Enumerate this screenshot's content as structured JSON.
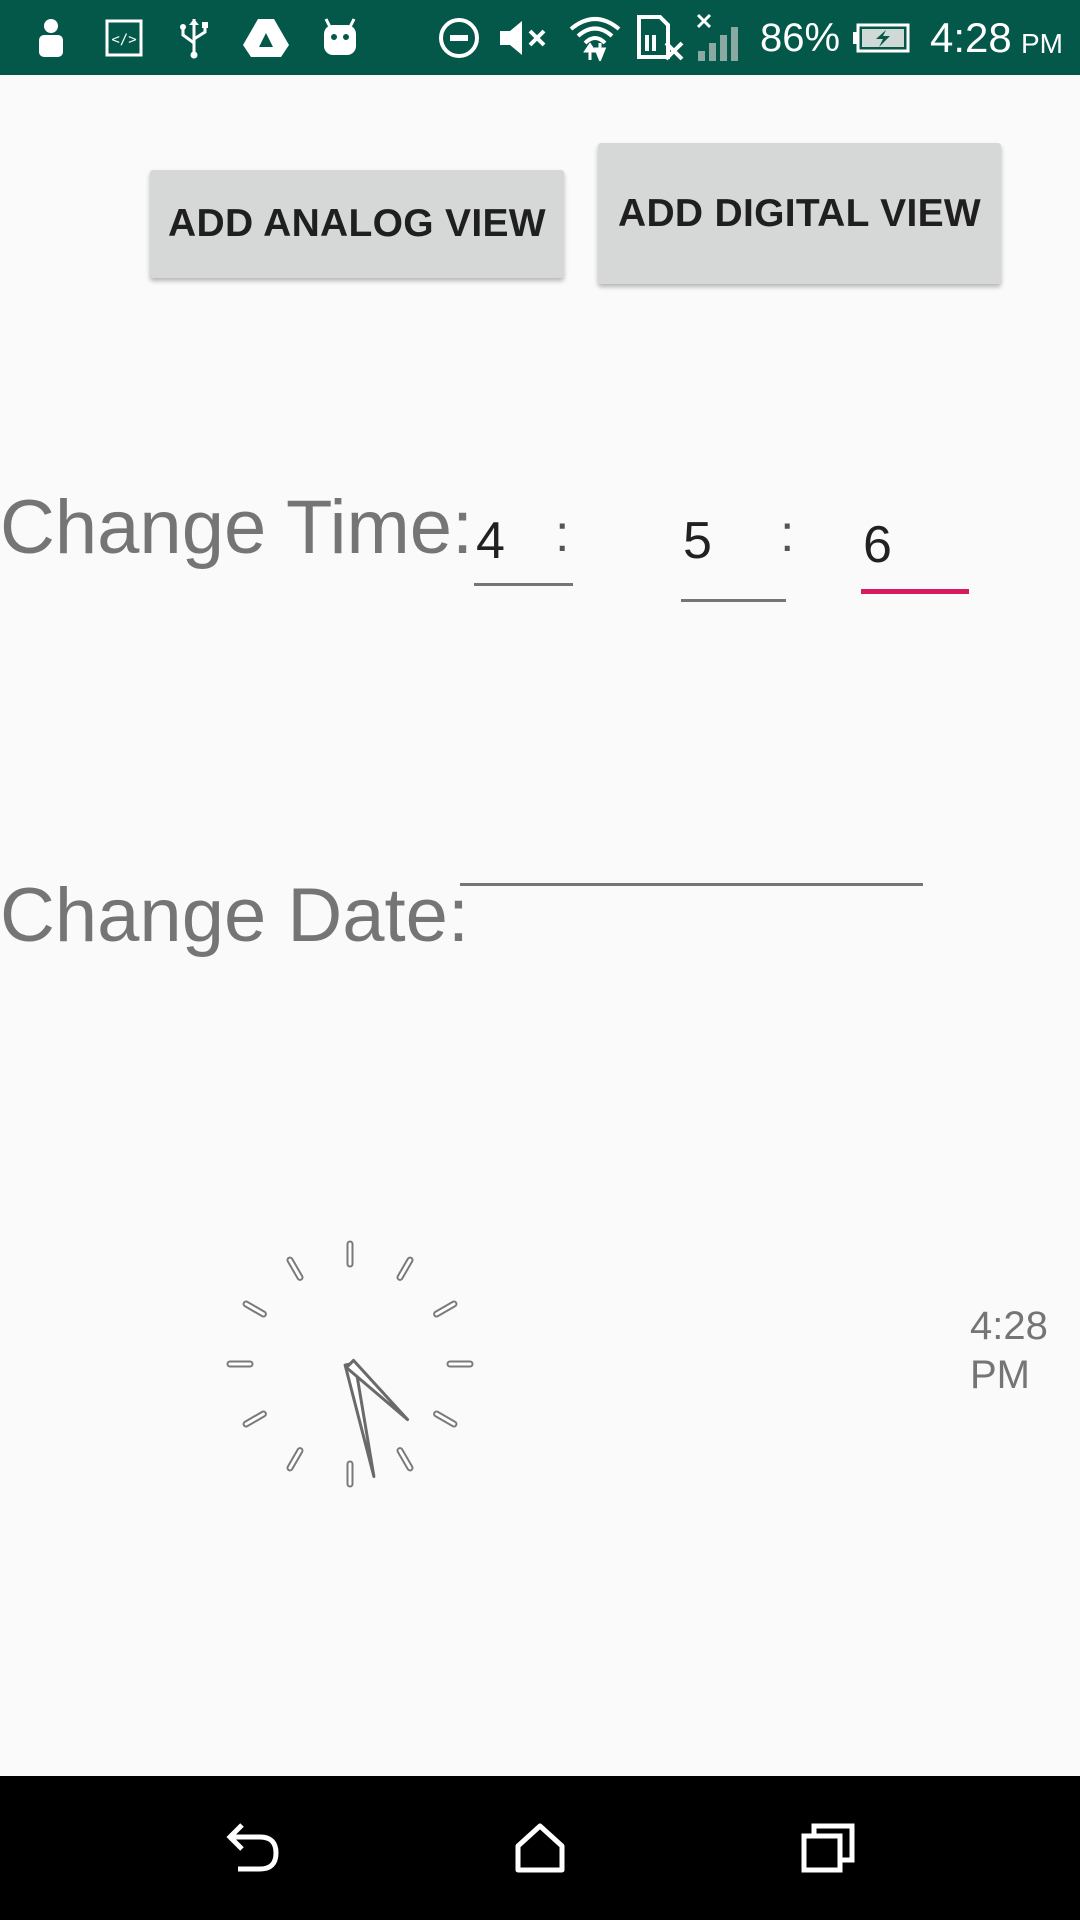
{
  "status_bar": {
    "battery_percent": "86%",
    "time": "4:28",
    "ampm": "PM",
    "icons": [
      "person-icon",
      "code-icon",
      "usb-icon",
      "drive-icon",
      "android-icon",
      "do-not-disturb-icon",
      "mute-icon",
      "wifi-icon",
      "no-sim-icon",
      "signal-icon",
      "battery-charging-icon"
    ]
  },
  "buttons": {
    "analog": "ADD ANALOG VIEW",
    "digital": "ADD DIGITAL VIEW"
  },
  "time_row": {
    "label": "Change Time:",
    "hour": "4",
    "minute": "5",
    "second": "6",
    "separator": ":"
  },
  "date_row": {
    "label": "Change Date:",
    "value": ""
  },
  "analog_clock": {
    "hour": 4,
    "minute": 28
  },
  "digital_clock": {
    "time": "4:28",
    "ampm": "PM"
  },
  "nav_bar": {
    "icons": [
      "back-icon",
      "home-icon",
      "recents-icon"
    ]
  },
  "colors": {
    "status_bar": "#045849",
    "accent": "#d81b60",
    "button": "#d6d7d7",
    "label": "#757575"
  }
}
